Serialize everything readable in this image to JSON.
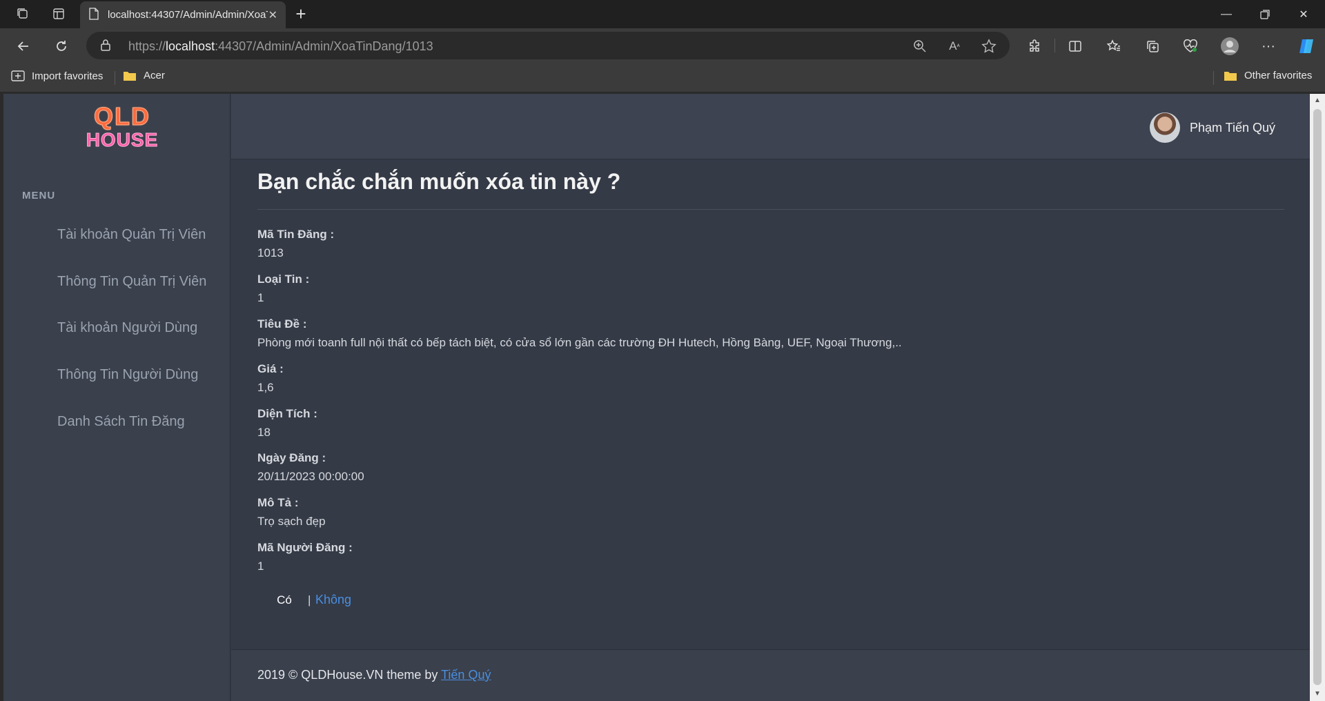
{
  "browser": {
    "tab_title": "localhost:44307/Admin/Admin/XoaTinDang/1013",
    "url_scheme": "https://",
    "url_host": "localhost",
    "url_rest": ":44307/Admin/Admin/XoaTinDang/1013",
    "favorites": {
      "import": "Import favorites",
      "acer": "Acer",
      "other": "Other favorites"
    }
  },
  "sidebar": {
    "logo_line1": "QLD",
    "logo_line2": "HOUSE",
    "menu_title": "MENU",
    "items": [
      {
        "label": "Tài khoản Quản Trị Viên"
      },
      {
        "label": "Thông Tin Quản Trị Viên"
      },
      {
        "label": "Tài khoản Người Dùng"
      },
      {
        "label": "Thông Tin Người Dùng"
      },
      {
        "label": "Danh Sách Tin Đăng"
      }
    ]
  },
  "header": {
    "user_name": "Phạm Tiến Quý"
  },
  "main": {
    "heading": "Bạn chắc chắn muốn xóa tin này ?",
    "fields": [
      {
        "label": "Mã Tin Đăng :",
        "value": "1013"
      },
      {
        "label": "Loại Tin :",
        "value": "1"
      },
      {
        "label": "Tiêu Đề :",
        "value": "Phòng mới toanh full nội thất có bếp tách biệt, có cửa sổ lớn gần các trường ĐH Hutech, Hồng Bàng, UEF, Ngoại Thương,.."
      },
      {
        "label": "Giá :",
        "value": "1,6"
      },
      {
        "label": "Diện Tích :",
        "value": "18"
      },
      {
        "label": "Ngày Đăng :",
        "value": "20/11/2023 00:00:00"
      },
      {
        "label": "Mô Tả :",
        "value": "Trọ sạch đẹp"
      },
      {
        "label": "Mã Người Đăng :",
        "value": "1"
      }
    ],
    "yes_label": "Có",
    "separator": "|",
    "no_label": "Không"
  },
  "footer": {
    "text": "2019 © QLDHouse.VN theme by",
    "link": "Tiến Quý"
  }
}
